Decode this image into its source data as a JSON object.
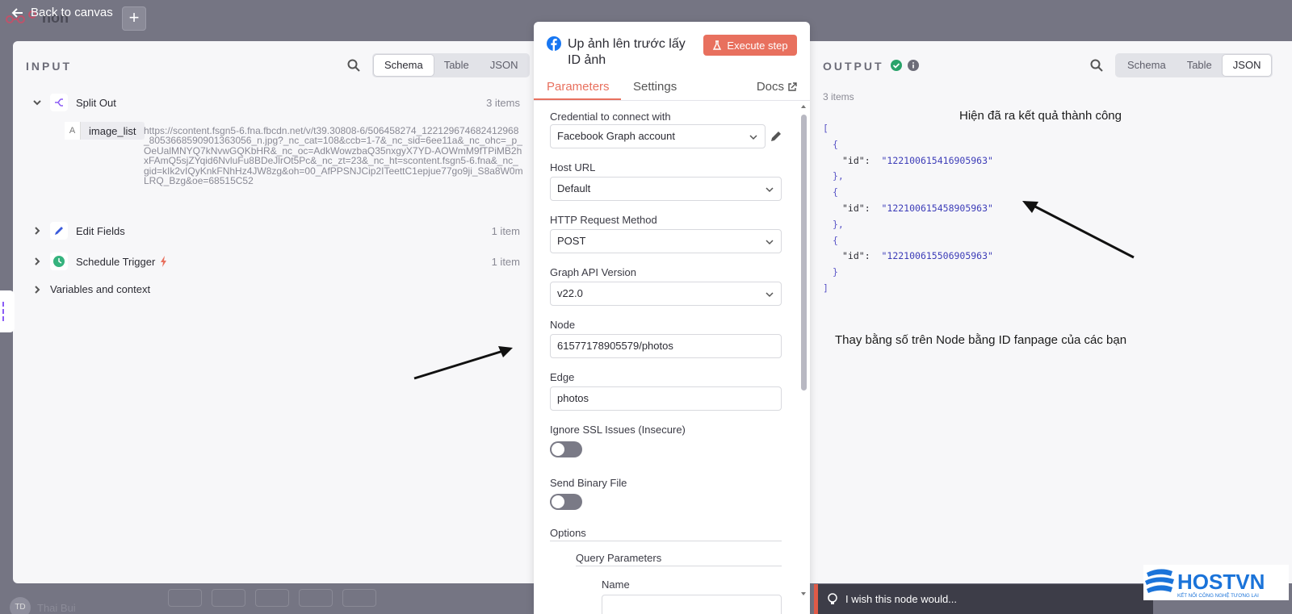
{
  "topbar": {
    "back_label": "Back to canvas",
    "canvas_title": "hon",
    "plus_label": "+",
    "user_initials": "TD",
    "user_name": "Thai Bui"
  },
  "input": {
    "label": "INPUT",
    "views": [
      "Schema",
      "Table",
      "JSON"
    ],
    "active_view": "Schema",
    "nodes": [
      {
        "name": "Split Out",
        "count": "3 items",
        "expanded": true
      },
      {
        "name": "Edit Fields",
        "count": "1 item",
        "expanded": false
      },
      {
        "name": "Schedule Trigger",
        "count": "1 item",
        "expanded": false
      }
    ],
    "field": {
      "type": "A",
      "name": "image_list",
      "value": "https://scontent.fsgn5-6.fna.fbcdn.net/v/t39.30808-6/506458274_122129674682412968_8053668590901363056_n.jpg?_nc_cat=108&ccb=1-7&_nc_sid=6ee11a&_nc_ohc=_p_OeUalMNYQ7kNvwGQKbHR&_nc_oc=AdkWowzbaQ35nxgyX7YD-AOWmM9fTPiMB2hxFAmQ5sjZYqid6NvluFu8BDeJlrOt5Pc&_nc_zt=23&_nc_ht=scontent.fsgn5-6.fna&_nc_gid=kIk2vIQyKnkFNhHz4JW8zg&oh=00_AfPPSNJCip2ITeettC1epjue77go9ji_S8a8W0mLRQ_Bzg&oe=68515C52"
    },
    "variables_label": "Variables and context"
  },
  "node": {
    "title": "Up ảnh lên trước lấy ID ảnh",
    "execute_label": "Execute step",
    "tabs": [
      "Parameters",
      "Settings"
    ],
    "docs_label": "Docs",
    "params": {
      "credential_label": "Credential to connect with",
      "credential_value": "Facebook Graph account",
      "host_label": "Host URL",
      "host_value": "Default",
      "method_label": "HTTP Request Method",
      "method_value": "POST",
      "version_label": "Graph API Version",
      "version_value": "v22.0",
      "node_label": "Node",
      "node_value": "61577178905579/photos",
      "edge_label": "Edge",
      "edge_value": "photos",
      "ssl_label": "Ignore SSL Issues (Insecure)",
      "binary_label": "Send Binary File",
      "options_label": "Options",
      "query_label": "Query Parameters",
      "name_label": "Name"
    }
  },
  "output": {
    "label": "OUTPUT",
    "count": "3 items",
    "views": [
      "Schema",
      "Table",
      "JSON"
    ],
    "active_view": "JSON",
    "json_key": "\"id\"",
    "ids": [
      "\"122100615416905963\"",
      "\"122100615458905963\"",
      "\"122100615506905963\""
    ]
  },
  "annotations": {
    "success_note": "Hiện đã ra kết quả thành công",
    "node_note": "Thay bằng số trên Node bằng ID fanpage của các bạn"
  },
  "footer": {
    "wish_label": "I wish this node would..."
  },
  "brand": {
    "name": "HOSTVN",
    "tagline": "KẾT NỐI CÔNG NGHỆ TƯƠNG LAI"
  },
  "colors": {
    "accent": "#e8705e",
    "success": "#29a36a",
    "json_string": "#3d3db8",
    "brand_blue": "#1a73d9"
  }
}
